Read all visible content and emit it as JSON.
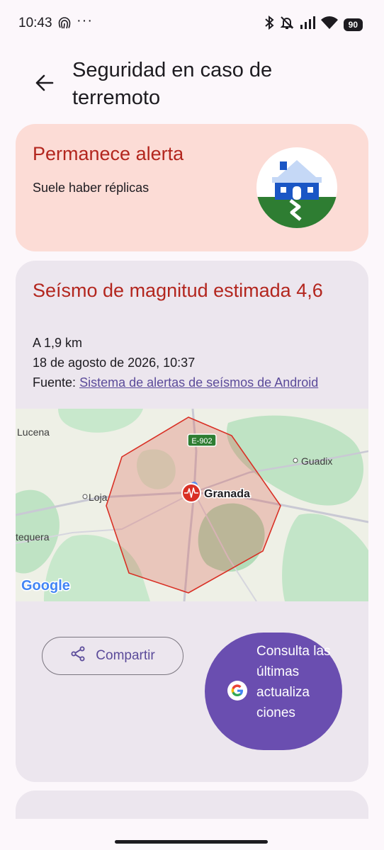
{
  "status_bar": {
    "time": "10:43",
    "more": "···",
    "battery": "90"
  },
  "header": {
    "back_icon": "arrow-left-icon",
    "title": "Seguridad en caso de terremoto"
  },
  "alert_card": {
    "title": "Permanece alerta",
    "subtitle": "Suele haber réplicas",
    "icon": "house-earthquake-icon",
    "colors": {
      "background": "#fcdcd6",
      "title": "#b3261e"
    }
  },
  "quake_card": {
    "title": "Seísmo de magnitud estimada 4,6",
    "distance": "A 1,9 km",
    "datetime": "18 de agosto de 2026, 10:37",
    "source_label": "Fuente:",
    "source_link": "Sistema de alertas de seísmos de Android",
    "map": {
      "labels": {
        "road": "E-902",
        "lucena": "Lucena",
        "guadix": "Guadix",
        "loja": "Loja",
        "granada": "Granada",
        "antequera": "tequera",
        "logo": "Google"
      }
    },
    "share_button": "Compartir",
    "updates_button": "Consulta las últimas actualiza ciones"
  },
  "colors": {
    "accent": "#6a4eb0",
    "alert_red": "#b3261e",
    "epicenter": "#d93025"
  }
}
